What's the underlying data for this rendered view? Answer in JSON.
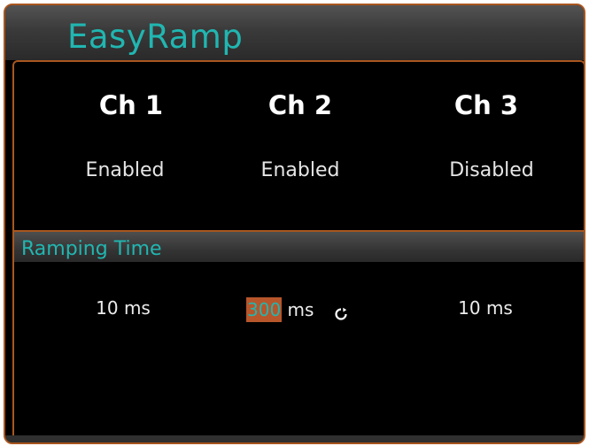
{
  "header": {
    "title": "EasyRamp"
  },
  "channels": [
    {
      "label": "Ch 1",
      "status": "Enabled"
    },
    {
      "label": "Ch 2",
      "status": "Enabled"
    },
    {
      "label": "Ch 3",
      "status": "Disabled"
    }
  ],
  "ramping": {
    "section_title": "Ramping Time",
    "values": [
      {
        "value": "10",
        "unit": "ms"
      },
      {
        "value_selected": "300",
        "unit": "ms",
        "icon": "cycle-icon"
      },
      {
        "value": "10",
        "unit": "ms"
      }
    ]
  },
  "colors": {
    "accent_teal": "#21b6b1",
    "border_orange": "#a8561f",
    "selection_orange": "#b7562b"
  }
}
